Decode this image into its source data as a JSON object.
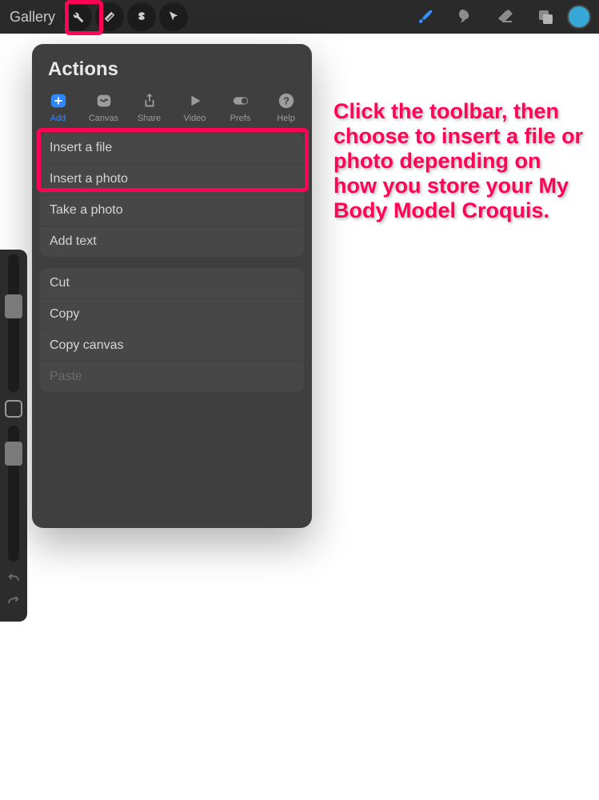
{
  "toolbar": {
    "gallery_label": "Gallery"
  },
  "panel": {
    "title": "Actions",
    "tabs": [
      {
        "label": "Add"
      },
      {
        "label": "Canvas"
      },
      {
        "label": "Share"
      },
      {
        "label": "Video"
      },
      {
        "label": "Prefs"
      },
      {
        "label": "Help"
      }
    ],
    "group1": [
      "Insert a file",
      "Insert a photo",
      "Take a photo",
      "Add text"
    ],
    "group2": [
      "Cut",
      "Copy",
      "Copy canvas",
      "Paste"
    ]
  },
  "annotation": "Click the toolbar, then choose to insert a file or photo depending on how you store your My Body Model Croquis.",
  "colors": {
    "accent": "#2f87ff",
    "highlight": "#ff0357",
    "swatch": "#36a8d6"
  }
}
